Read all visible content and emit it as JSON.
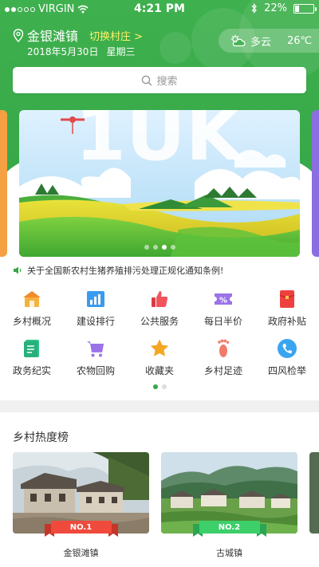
{
  "status_bar": {
    "carrier": "VIRGIN",
    "time": "4:21 PM",
    "battery": "22%",
    "battery_level": 0.22
  },
  "location": {
    "name": "金银滩镇",
    "switch_label": "切换村庄 >"
  },
  "date": {
    "day": "2018年5月30日",
    "weekday": "星期三"
  },
  "weather": {
    "condition": "多云",
    "temperature": "26℃",
    "icon": "cloud-sun-icon"
  },
  "search": {
    "placeholder": "搜索",
    "icon": "search-icon"
  },
  "banner": {
    "slide_count": 4,
    "active_index": 2
  },
  "notice": {
    "icon": "speaker-icon",
    "text": "关于全国新农村生猪养殖排污处理正规化通知条例!"
  },
  "shortcuts": [
    {
      "label": "乡村概况",
      "icon": "house-icon",
      "color": "#f5a636"
    },
    {
      "label": "建设排行",
      "icon": "bar-chart-icon",
      "color": "#3a9bf0"
    },
    {
      "label": "公共服务",
      "icon": "thumbs-up-icon",
      "color": "#f2545b"
    },
    {
      "label": "每日半价",
      "icon": "percent-ticket-icon",
      "color": "#9b72e8"
    },
    {
      "label": "政府补贴",
      "icon": "red-envelope-icon",
      "color": "#ef4040"
    },
    {
      "label": "政务纪实",
      "icon": "document-icon",
      "color": "#2fc28a"
    },
    {
      "label": "农物回购",
      "icon": "cart-icon",
      "color": "#9b72e8"
    },
    {
      "label": "收藏夹",
      "icon": "star-icon",
      "color": "#f5a623"
    },
    {
      "label": "乡村足迹",
      "icon": "footprint-icon",
      "color": "#f27a6b"
    },
    {
      "label": "四风检举",
      "icon": "phone-icon",
      "color": "#3aa5ef"
    }
  ],
  "shortcut_pages": {
    "count": 2,
    "active_index": 0
  },
  "hot_villages": {
    "title": "乡村热度榜",
    "items": [
      {
        "rank": "NO.1",
        "name": "金银滩镇",
        "ribbon_color": "#ef4a3c"
      },
      {
        "rank": "NO.2",
        "name": "古城镇",
        "ribbon_color": "#3ccf6a"
      }
    ]
  }
}
